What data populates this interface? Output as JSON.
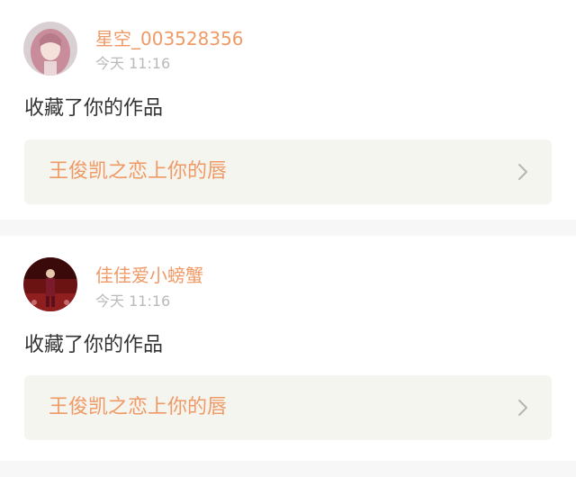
{
  "notifications": [
    {
      "username": "星空_003528356",
      "time": "今天 11:16",
      "action": "收藏了你的作品",
      "work_title": "王俊凯之恋上你的唇",
      "avatar_icon": "avatar-pink-hair-icon",
      "chevron_icon": "chevron-right-icon"
    },
    {
      "username": "佳佳爱小螃蟹",
      "time": "今天 11:16",
      "action": "收藏了你的作品",
      "work_title": "王俊凯之恋上你的唇",
      "avatar_icon": "avatar-runway-icon",
      "chevron_icon": "chevron-right-icon"
    }
  ],
  "colors": {
    "username": "#ef9a66",
    "time": "#b9b9b9",
    "action": "#333333",
    "work_bg": "#f5f5ef",
    "separator": "#f7f7f7"
  }
}
